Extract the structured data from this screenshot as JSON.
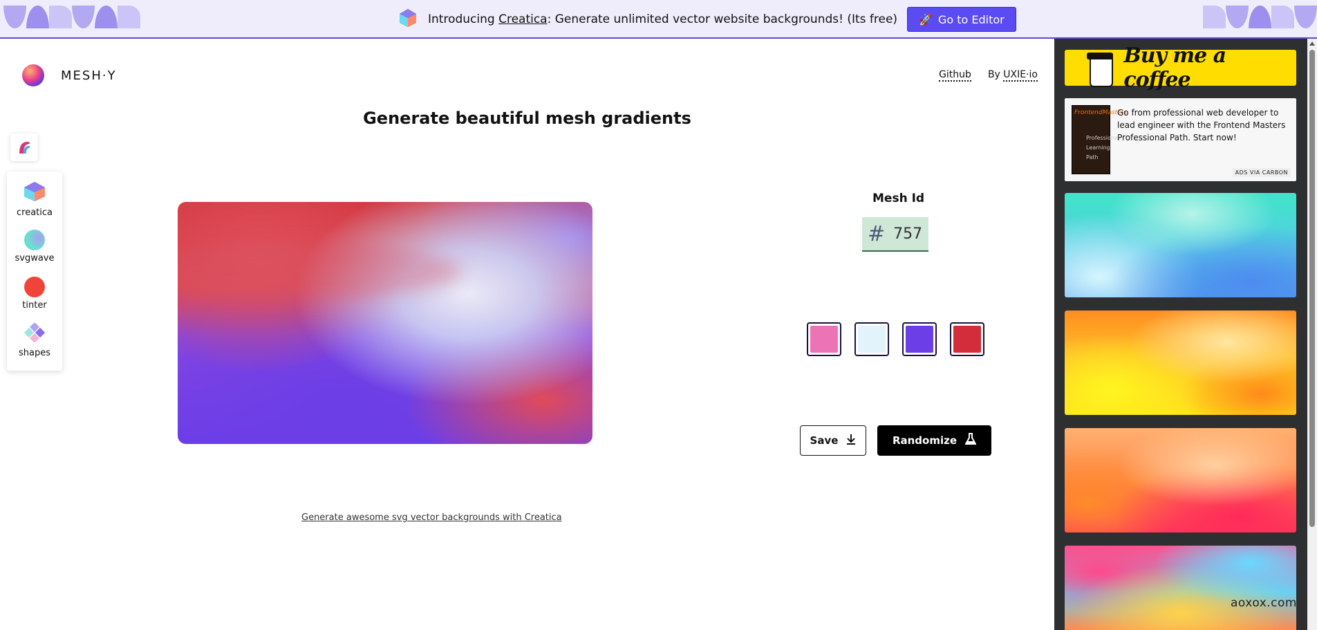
{
  "banner": {
    "prefix": "Introducing ",
    "link": "Creatica",
    "suffix": ": Generate unlimited vector website backgrounds! (Its free)",
    "button_label": "Go to Editor",
    "button_icon": "rocket-icon"
  },
  "header": {
    "brand": "MESH·Y",
    "github": "Github",
    "by_prefix": "By ",
    "by_link": "UXIE·io"
  },
  "title": "Generate beautiful mesh gradients",
  "sidebar": {
    "top_icon": "app-logo-icon",
    "items": [
      {
        "label": "creatica",
        "icon": "cube-icon"
      },
      {
        "label": "svgwave",
        "icon": "wave-icon"
      },
      {
        "label": "tinter",
        "icon": "circle-icon"
      },
      {
        "label": "shapes",
        "icon": "shapes-icon"
      }
    ]
  },
  "mesh": {
    "id_label": "Mesh Id",
    "hash": "#",
    "id": "757",
    "colors": [
      "#ec74b6",
      "#e2f3fc",
      "#6b3ee8",
      "#d32d3b"
    ]
  },
  "actions": {
    "save": "Save",
    "randomize": "Randomize"
  },
  "footer_link": "Generate awesome svg vector backgrounds with Creatica",
  "right_panel": {
    "coffee": "Buy me a coffee",
    "ad_text": "Go from professional web developer to lead engineer with the Frontend Masters Professional Path. Start now!",
    "ad_image_title": "FrontendMasters",
    "ad_image_sub": "Professional Learning Path",
    "ad_via": "ADS VIA CARBON"
  },
  "watermark": "aoxox.com"
}
